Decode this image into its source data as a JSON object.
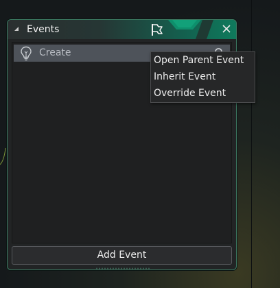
{
  "panel": {
    "title": "Events",
    "accent_color": "#0f7a5c",
    "icons": [
      "collapse-arrow-icon",
      "flag-icon",
      "close-icon"
    ]
  },
  "events": {
    "items": [
      {
        "label": "Create",
        "icon": "lightbulb-icon"
      }
    ],
    "search_icon": "search-icon"
  },
  "add_button": {
    "label": "Add Event"
  },
  "context_menu": {
    "items": [
      {
        "label": "Open Parent Event"
      },
      {
        "label": "Inherit Event"
      },
      {
        "label": "Override Event"
      }
    ]
  }
}
